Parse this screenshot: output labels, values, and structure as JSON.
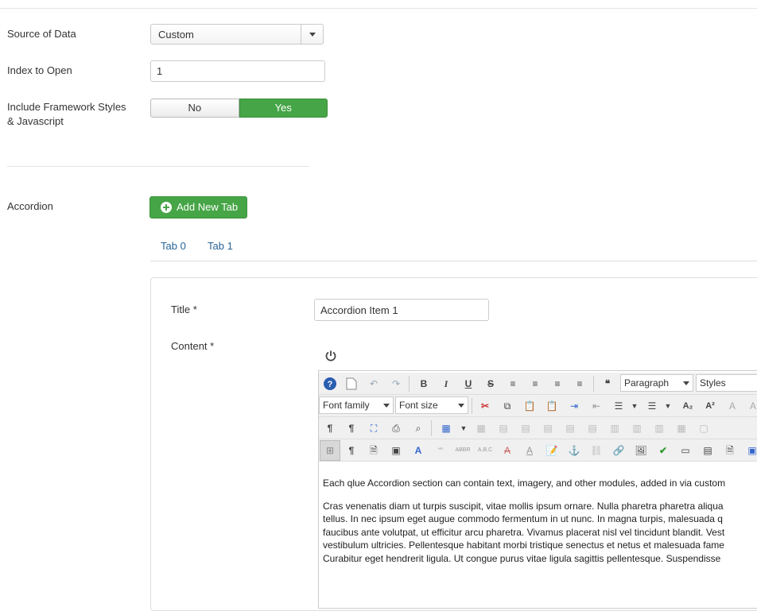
{
  "form": {
    "source_label": "Source of Data",
    "source_value": "Custom",
    "index_label": "Index to Open",
    "index_value": "1",
    "framework_label_1": "Include Framework Styles",
    "framework_label_2": "& Javascript",
    "toggle_no": "No",
    "toggle_yes": "Yes",
    "toggle_selected": "Yes",
    "accordion_label": "Accordion",
    "add_tab_label": "Add New Tab"
  },
  "tabs": [
    {
      "label": "Tab 0"
    },
    {
      "label": "Tab 1"
    }
  ],
  "item": {
    "title_label": "Title *",
    "title_value": "Accordion Item 1",
    "content_label": "Content *"
  },
  "editor": {
    "paragraph_select": "Paragraph",
    "styles_select": "Styles",
    "font_family_select": "Font family",
    "font_size_select": "Font size",
    "content_p1": "Each qlue Accordion section can contain text, imagery, and other modules, added in via custom",
    "content_p2_lines": [
      "Cras venenatis diam ut turpis suscipit, vitae mollis ipsum ornare. Nulla pharetra pharetra aliqua",
      "tellus. In nec ipsum eget augue commodo fermentum in ut nunc. In magna turpis, malesuada q",
      "faucibus ante volutpat, ut efficitur arcu pharetra. Vivamus placerat nisl vel tincidunt blandit. Vest",
      "vestibulum ultricies. Pellentesque habitant morbi tristique senectus et netus et malesuada fame",
      "Curabitur eget hendrerit ligula. Ut congue purus vitae ligula sagittis pellentesque. Suspendisse"
    ]
  },
  "colors": {
    "green": "#46a546",
    "link": "#2a6496"
  }
}
